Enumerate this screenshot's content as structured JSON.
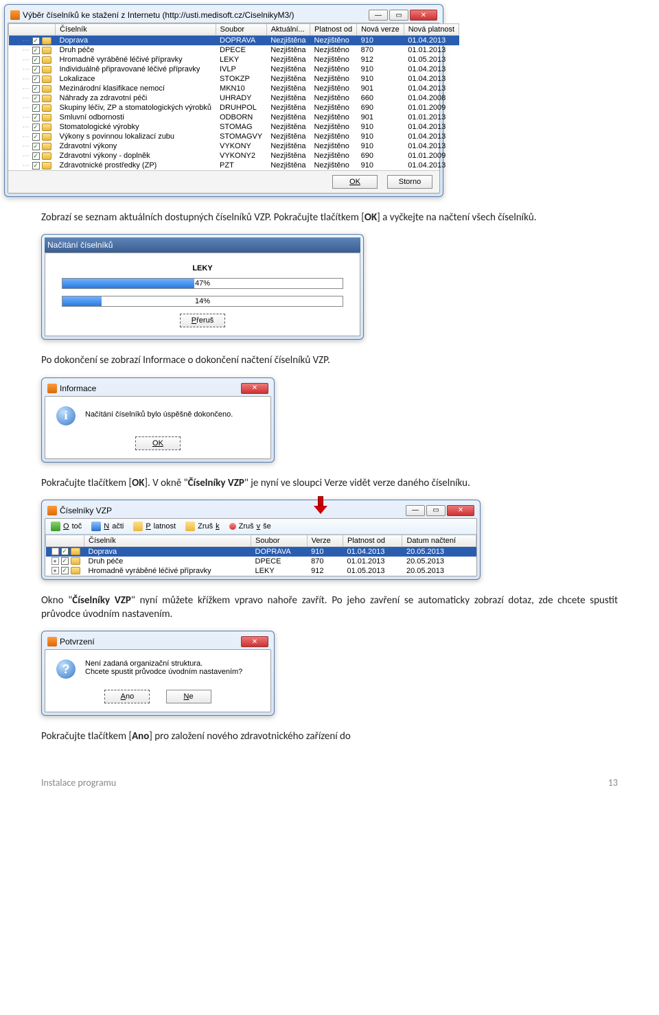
{
  "win1": {
    "title": "Výběr číselníků ke stažení z Internetu (http://usti.medisoft.cz/CiselnikyM3/)",
    "headers": [
      "Číselník",
      "Soubor",
      "Aktuální...",
      "Platnost od",
      "Nová verze",
      "Nová platnost"
    ],
    "rows": [
      {
        "chk": true,
        "name": "Doprava",
        "file": "DOPRAVA",
        "akt": "Nezjištěna",
        "plat": "Nezjištěno",
        "ver": "910",
        "nplat": "01.04.2013",
        "sel": true
      },
      {
        "chk": true,
        "name": "Druh péče",
        "file": "DPECE",
        "akt": "Nezjištěna",
        "plat": "Nezjištěno",
        "ver": "870",
        "nplat": "01.01.2013"
      },
      {
        "chk": true,
        "name": "Hromadně vyráběné léčivé přípravky",
        "file": "LEKY",
        "akt": "Nezjištěna",
        "plat": "Nezjištěno",
        "ver": "912",
        "nplat": "01.05.2013"
      },
      {
        "chk": true,
        "name": "Individuálně připravované léčivé přípravky",
        "file": "IVLP",
        "akt": "Nezjištěna",
        "plat": "Nezjištěno",
        "ver": "910",
        "nplat": "01.04.2013"
      },
      {
        "chk": true,
        "name": "Lokalizace",
        "file": "STOKZP",
        "akt": "Nezjištěna",
        "plat": "Nezjištěno",
        "ver": "910",
        "nplat": "01.04.2013"
      },
      {
        "chk": true,
        "name": "Mezinárodní klasifikace nemocí",
        "file": "MKN10",
        "akt": "Nezjištěna",
        "plat": "Nezjištěno",
        "ver": "901",
        "nplat": "01.04.2013"
      },
      {
        "chk": true,
        "name": "Náhrady za zdravotní péči",
        "file": "UHRADY",
        "akt": "Nezjištěna",
        "plat": "Nezjištěno",
        "ver": "660",
        "nplat": "01.04.2008"
      },
      {
        "chk": true,
        "name": "Skupiny léčiv, ZP a stomatologických výrobků",
        "file": "DRUHPOL",
        "akt": "Nezjištěna",
        "plat": "Nezjištěno",
        "ver": "690",
        "nplat": "01.01.2009"
      },
      {
        "chk": true,
        "name": "Smluvní odbornosti",
        "file": "ODBORN",
        "akt": "Nezjištěna",
        "plat": "Nezjištěno",
        "ver": "901",
        "nplat": "01.01.2013"
      },
      {
        "chk": true,
        "name": "Stomatologické výrobky",
        "file": "STOMAG",
        "akt": "Nezjištěna",
        "plat": "Nezjištěno",
        "ver": "910",
        "nplat": "01.04.2013"
      },
      {
        "chk": true,
        "name": "Výkony s povinnou lokalizací zubu",
        "file": "STOMAGVY",
        "akt": "Nezjištěna",
        "plat": "Nezjištěno",
        "ver": "910",
        "nplat": "01.04.2013"
      },
      {
        "chk": true,
        "name": "Zdravotní výkony",
        "file": "VYKONY",
        "akt": "Nezjištěna",
        "plat": "Nezjištěno",
        "ver": "910",
        "nplat": "01.04.2013"
      },
      {
        "chk": true,
        "name": "Zdravotní výkony - doplněk",
        "file": "VYKONY2",
        "akt": "Nezjištěna",
        "plat": "Nezjištěno",
        "ver": "690",
        "nplat": "01.01.2009"
      },
      {
        "chk": true,
        "name": "Zdravotnické prostředky (ZP)",
        "file": "PZT",
        "akt": "Nezjištěna",
        "plat": "Nezjištěno",
        "ver": "910",
        "nplat": "01.04.2013"
      }
    ],
    "btn_ok": "OK",
    "btn_storno": "Storno"
  },
  "para1a": "Zobrazí se seznam aktuálních dostupných číselníků VZP. Pokračujte tlačítkem [",
  "para1b": "OK",
  "para1c": "] a vyčkejte na načtení všech číselníků.",
  "winProg": {
    "title": "Načítání číselníků",
    "label": "LEKY",
    "p1": 47,
    "p1t": "47%",
    "p2": 14,
    "p2t": "14%",
    "btn": "Přeruš"
  },
  "para2": "Po dokončení se zobrazí Informace o dokončení načtení číselníků VZP.",
  "winInfo": {
    "title": "Informace",
    "text": "Načítání číselníků bylo úspěšně dokončeno.",
    "btn": "OK"
  },
  "para3a": "Pokračujte tlačítkem [",
  "para3b": "OK",
  "para3c": "]. V okně \"",
  "para3d": "Číselníky VZP",
  "para3e": "\" je nyní ve sloupci Verze vidět verze daného číselníku.",
  "winVZP": {
    "title": "Číselníky VZP",
    "toolbar": {
      "otoc": "Otoč",
      "nacti": "Načti",
      "platnost": "Platnost",
      "zrusk": "Zruš k",
      "zrusvse": "Zruš vše"
    },
    "headers": [
      "Číselník",
      "Soubor",
      "Verze",
      "Platnost od",
      "Datum načtení"
    ],
    "rows": [
      {
        "name": "Doprava",
        "file": "DOPRAVA",
        "ver": "910",
        "plat": "01.04.2013",
        "dat": "20.05.2013",
        "sel": true,
        "exp": "-"
      },
      {
        "name": "Druh péče",
        "file": "DPECE",
        "ver": "870",
        "plat": "01.01.2013",
        "dat": "20.05.2013",
        "exp": "+"
      },
      {
        "name": "Hromadně vyráběné léčivé přípravky",
        "file": "LEKY",
        "ver": "912",
        "plat": "01.05.2013",
        "dat": "20.05.2013",
        "exp": "+"
      }
    ]
  },
  "para4a": "Okno \"",
  "para4b": "Číselníky VZP",
  "para4c": "\" nyní můžete křížkem vpravo nahoře zavřít. Po jeho zavření se automaticky zobrazí dotaz, zde chcete spustit průvodce úvodním nastavením.",
  "winConfirm": {
    "title": "Potvrzení",
    "text1": "Není zadaná organizační struktura.",
    "text2": "Chcete spustit průvodce úvodním nastavením?",
    "btn_yes": "Ano",
    "btn_no": "Ne"
  },
  "para5a": "Pokračujte tlačítkem [",
  "para5b": "Ano",
  "para5c": "] pro založení nového zdravotnického zařízení do",
  "footer_left": "Instalace programu",
  "footer_right": "13"
}
